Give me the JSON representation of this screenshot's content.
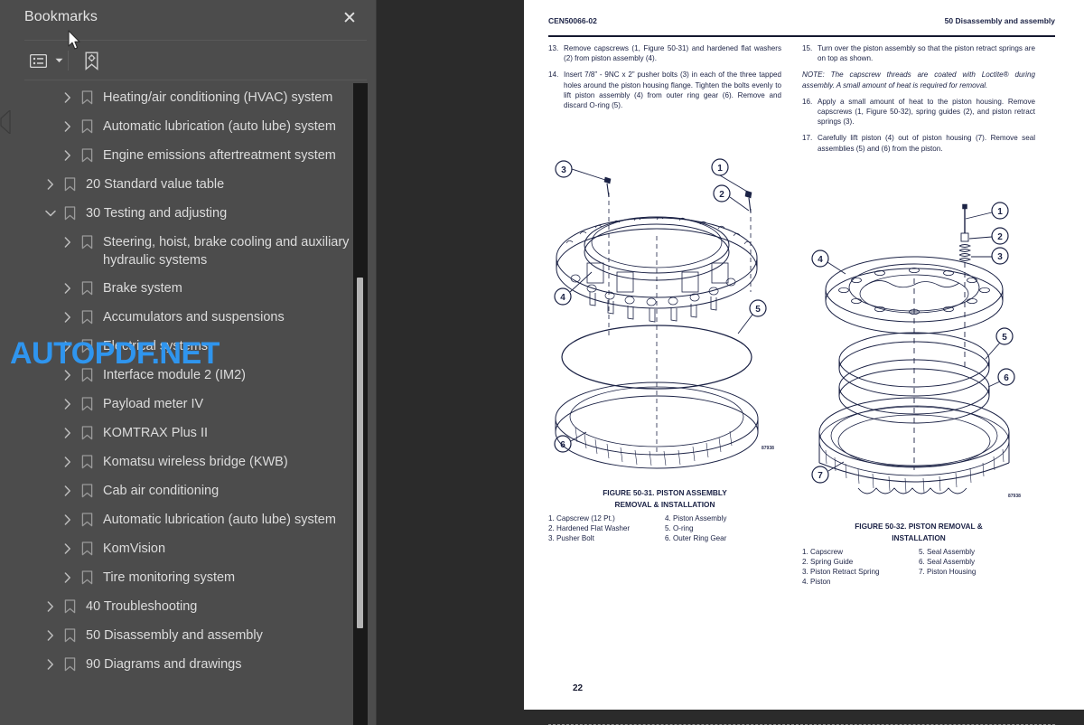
{
  "panel": {
    "title": "Bookmarks",
    "close_label": "✕",
    "toolbar": {
      "options_icon": "list-options-icon",
      "caret_icon": "chevron-down-icon",
      "new_bookmark_icon": "new-bookmark-icon"
    },
    "items": [
      {
        "label": "Heating/air conditioning (HVAC) system",
        "level": 2,
        "expanded": false
      },
      {
        "label": "Automatic lubrication (auto lube) system",
        "level": 2,
        "expanded": false
      },
      {
        "label": "Engine emissions aftertreatment system",
        "level": 2,
        "expanded": false
      },
      {
        "label": "20 Standard value table",
        "level": 1,
        "expanded": false
      },
      {
        "label": "30 Testing and adjusting",
        "level": 1,
        "expanded": true
      },
      {
        "label": "Steering, hoist, brake cooling and auxiliary hydraulic systems",
        "level": 2,
        "expanded": false
      },
      {
        "label": "Brake system",
        "level": 2,
        "expanded": false
      },
      {
        "label": "Accumulators and suspensions",
        "level": 2,
        "expanded": false
      },
      {
        "label": "Electrical systems",
        "level": 2,
        "expanded": false
      },
      {
        "label": "Interface module 2 (IM2)",
        "level": 2,
        "expanded": false
      },
      {
        "label": "Payload meter IV",
        "level": 2,
        "expanded": false
      },
      {
        "label": "KOMTRAX Plus II",
        "level": 2,
        "expanded": false
      },
      {
        "label": "Komatsu wireless bridge (KWB)",
        "level": 2,
        "expanded": false
      },
      {
        "label": "Cab air conditioning",
        "level": 2,
        "expanded": false
      },
      {
        "label": "Automatic lubrication (auto lube) system",
        "level": 2,
        "expanded": false
      },
      {
        "label": "KomVision",
        "level": 2,
        "expanded": false
      },
      {
        "label": "Tire monitoring system",
        "level": 2,
        "expanded": false
      },
      {
        "label": "40 Troubleshooting",
        "level": 1,
        "expanded": false
      },
      {
        "label": "50 Disassembly and assembly",
        "level": 1,
        "expanded": false
      },
      {
        "label": "90 Diagrams and drawings",
        "level": 1,
        "expanded": false
      }
    ]
  },
  "watermark": "AUTOPDF.NET",
  "document": {
    "header_left": "CEN50066-02",
    "header_right": "50 Disassembly and assembly",
    "page_number": "22",
    "steps_left": [
      {
        "num": "13.",
        "text": "Remove capscrews (1, Figure 50-31) and hardened flat washers (2) from piston assembly (4)."
      },
      {
        "num": "14.",
        "text": "Insert 7/8” - 9NC x 2” pusher bolts (3) in each of the three tapped holes around the piston housing flange. Tighten the bolts evenly to lift piston assembly (4) from outer ring gear (6). Remove and discard O-ring (5)."
      }
    ],
    "steps_right": [
      {
        "num": "15.",
        "text": "Turn over the piston assembly so that the piston retract springs are on top as shown."
      },
      {
        "num": "16.",
        "text": "Apply a small amount of heat to the piston housing. Remove capscrews (1, Figure 50-32), spring guides (2), and piston retract springs (3)."
      },
      {
        "num": "17.",
        "text": "Carefully lift piston (4) out of piston housing (7). Remove seal assemblies (5) and (6) from the piston."
      }
    ],
    "note_right": "NOTE: The capscrew threads are coated with Loctite® during assembly. A small amount of heat is required for removal.",
    "figure_left": {
      "caption_line1": "FIGURE 50-31. PISTON ASSEMBLY",
      "caption_line2": "REMOVAL & INSTALLATION",
      "code": "87938",
      "legend_col1": [
        "1. Capscrew (12 Pt.)",
        "2. Hardened Flat Washer",
        "3. Pusher Bolt"
      ],
      "legend_col2": [
        "4. Piston Assembly",
        "5. O-ring",
        "6. Outer Ring Gear"
      ],
      "callouts": [
        "1",
        "2",
        "3",
        "4",
        "5",
        "6"
      ]
    },
    "figure_right": {
      "caption_line1": "FIGURE 50-32. PISTON REMOVAL &",
      "caption_line2": "INSTALLATION",
      "code": "87938",
      "legend_col1": [
        "1. Capscrew",
        "2. Spring Guide",
        "3. Piston Retract Spring",
        "4. Piston"
      ],
      "legend_col2": [
        "5. Seal Assembly",
        "6. Seal Assembly",
        "7. Piston Housing"
      ],
      "callouts": [
        "1",
        "2",
        "3",
        "4",
        "5",
        "6",
        "7"
      ]
    }
  },
  "colors": {
    "panel_bg": "#4c4c4c",
    "viewer_bg": "#2b2b2b",
    "page_bg": "#ffffff",
    "text": "#dcdcdc",
    "doc_ink": "#1b2245",
    "watermark": "#2f95ee",
    "scroll_track": "#191919",
    "scroll_thumb": "#b4b4b4"
  }
}
